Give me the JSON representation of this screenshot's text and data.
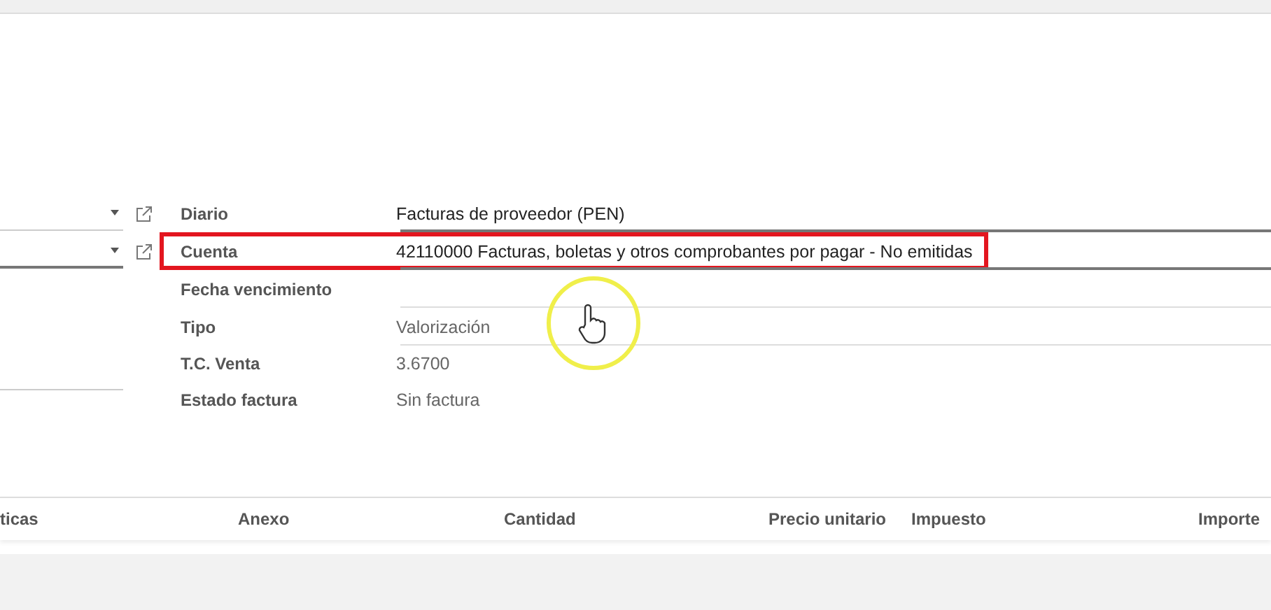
{
  "fields": [
    {
      "label": "Diario",
      "value": "Facturas de proveedor (PEN)",
      "kind": "many2one",
      "highlighted": false
    },
    {
      "label": "Cuenta",
      "value": "42110000 Facturas, boletas y otros comprobantes por pagar - No emitidas",
      "kind": "many2one",
      "highlighted": true
    },
    {
      "label": "Fecha vencimiento",
      "kind": "input",
      "highlighted": false
    },
    {
      "label": "Tipo",
      "value": "Valorización",
      "kind": "input",
      "highlighted": false
    },
    {
      "label": "T.C. Venta",
      "value": "3.6700",
      "kind": "readonly",
      "highlighted": false
    },
    {
      "label": "Estado factura",
      "value": "Sin factura",
      "kind": "readonly",
      "highlighted": false
    }
  ],
  "table": {
    "columns": [
      {
        "label": "ticas"
      },
      {
        "label": "Anexo"
      },
      {
        "label": "Cantidad"
      },
      {
        "label": "Precio unitario"
      },
      {
        "label": "Impuesto"
      },
      {
        "label": "Importe"
      }
    ]
  }
}
